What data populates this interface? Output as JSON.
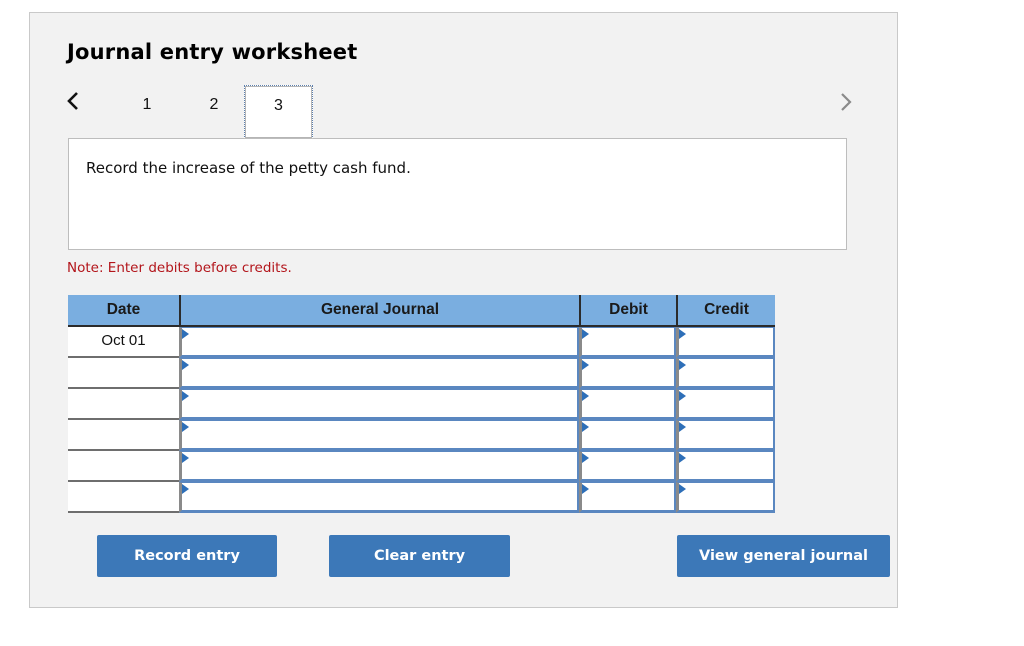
{
  "worksheet": {
    "title": "Journal entry worksheet",
    "nav": {
      "prev_icon": "chevron-left-icon",
      "next_icon": "chevron-right-icon",
      "tabs": [
        {
          "label": "1",
          "active": false
        },
        {
          "label": "2",
          "active": false
        },
        {
          "label": "3",
          "active": true
        }
      ]
    },
    "prompt": "Record the increase of the petty cash fund.",
    "note": "Note: Enter debits before credits.",
    "colors": {
      "panel_bg": "#f2f2f2",
      "header_bg": "#7aaee0",
      "button_bg": "#3c78b8",
      "note_text": "#b3151b",
      "input_marker": "#2e6fb8"
    }
  },
  "table": {
    "headers": {
      "date": "Date",
      "general_journal": "General Journal",
      "debit": "Debit",
      "credit": "Credit"
    },
    "rows": [
      {
        "date": "Oct 01",
        "account": "",
        "debit": "",
        "credit": ""
      },
      {
        "date": "",
        "account": "",
        "debit": "",
        "credit": ""
      },
      {
        "date": "",
        "account": "",
        "debit": "",
        "credit": ""
      },
      {
        "date": "",
        "account": "",
        "debit": "",
        "credit": ""
      },
      {
        "date": "",
        "account": "",
        "debit": "",
        "credit": ""
      },
      {
        "date": "",
        "account": "",
        "debit": "",
        "credit": ""
      }
    ]
  },
  "buttons": {
    "record_entry": "Record entry",
    "clear_entry": "Clear entry",
    "view_general_journal": "View general journal"
  }
}
